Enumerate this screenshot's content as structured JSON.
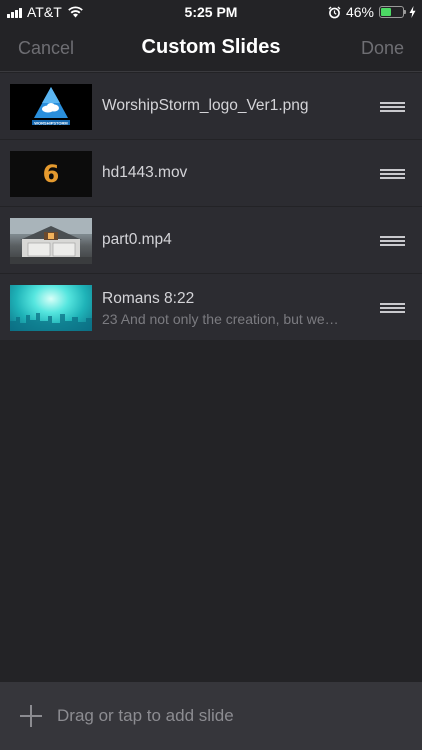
{
  "status_bar": {
    "carrier": "AT&T",
    "time": "5:25 PM",
    "battery_percent": "46%",
    "battery_level": 0.46,
    "colors": {
      "battery_fill": "#4cd964"
    },
    "icons": [
      "signal-icon",
      "wifi-icon",
      "alarm-icon",
      "battery-icon",
      "charging-bolt-icon"
    ]
  },
  "nav": {
    "cancel_label": "Cancel",
    "title": "Custom Slides",
    "done_label": "Done"
  },
  "slides": [
    {
      "name": "WorshipStorm_logo_Ver1.png",
      "subtitle": "",
      "thumb": "logo-image",
      "thumb_text": "WORSHIPSTORM"
    },
    {
      "name": "hd1443.mov",
      "subtitle": "",
      "thumb": "countdown-video",
      "thumb_text": "6"
    },
    {
      "name": "part0.mp4",
      "subtitle": "",
      "thumb": "house-video"
    },
    {
      "name": "Romans 8:22",
      "subtitle": "23 And not only the creation, but we…",
      "thumb": "scripture-background"
    }
  ],
  "add_bar": {
    "label": "Drag or tap to add slide",
    "icon": "plus-icon"
  },
  "colors": {
    "background": "#232326",
    "row_background": "#2c2c31",
    "muted_text": "#6e6e73",
    "add_bar_background": "#36363b"
  }
}
